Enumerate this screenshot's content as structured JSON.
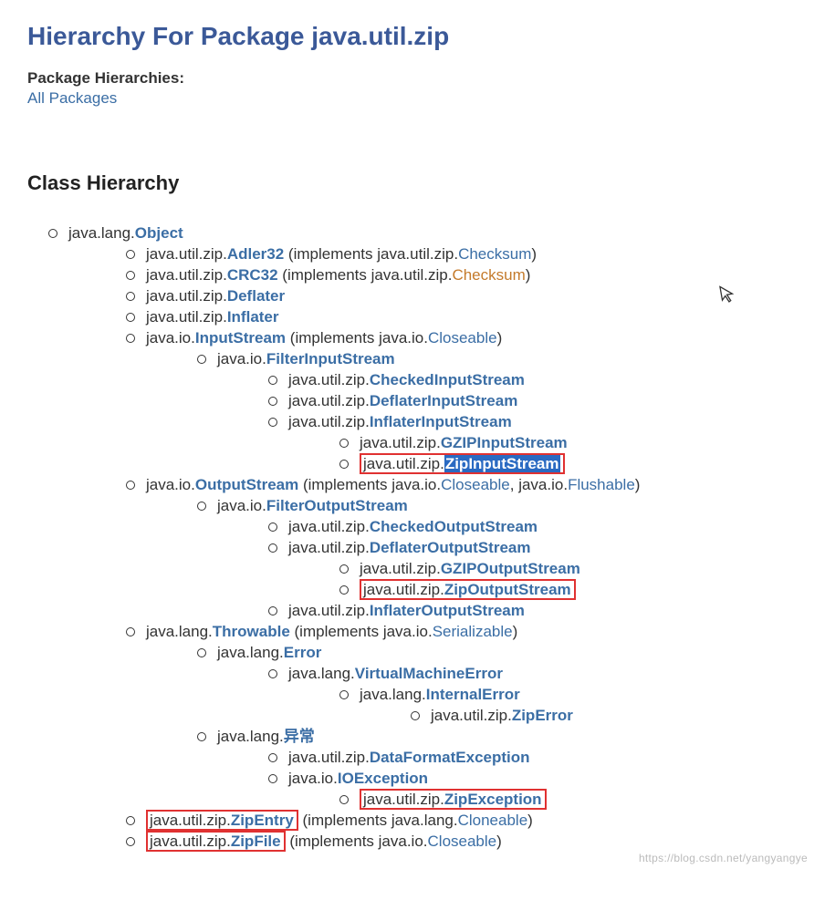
{
  "title": "Hierarchy For Package java.util.zip",
  "pkg_h_label": "Package Hierarchies:",
  "all_packages": "All Packages",
  "section": "Class Hierarchy",
  "t": {
    "jlang": "java.lang.",
    "jutilzip": "java.util.zip.",
    "jio": "java.io.",
    "object": "Object",
    "adler32": "Adler32",
    "crc32": "CRC32",
    "deflater": "Deflater",
    "inflater": "Inflater",
    "impl": " (implements ",
    "checksum": "Checksum",
    "inputstream": "InputStream",
    "closeable": "Closeable",
    "filterinput": "FilterInputStream",
    "checkedin": "CheckedInputStream",
    "deflaterin": "DeflaterInputStream",
    "inflaterin": "InflaterInputStream",
    "gzipin": "GZIPInputStream",
    "zipin": "ZipInputStream",
    "outputstream": "OutputStream",
    "flushable": "Flushable",
    "filterout": "FilterOutputStream",
    "checkedout": "CheckedOutputStream",
    "deflaterout": "DeflaterOutputStream",
    "gzipout": "GZIPOutputStream",
    "zipout": "ZipOutputStream",
    "inflaterout": "InflaterOutputStream",
    "throwable": "Throwable",
    "serializable": "Serializable",
    "error": "Error",
    "vmerror": "VirtualMachineError",
    "internalerr": "InternalError",
    "ziperror": "ZipError",
    "exception_cn": "异常",
    "dfexception": "DataFormatException",
    "ioexception": "IOException",
    "zipexception": "ZipException",
    "zipentry": "ZipEntry",
    "cloneable": "Cloneable",
    "zipfile": "ZipFile",
    "comma": ", ",
    "close": ")"
  },
  "watermark": "https://blog.csdn.net/yangyangye"
}
